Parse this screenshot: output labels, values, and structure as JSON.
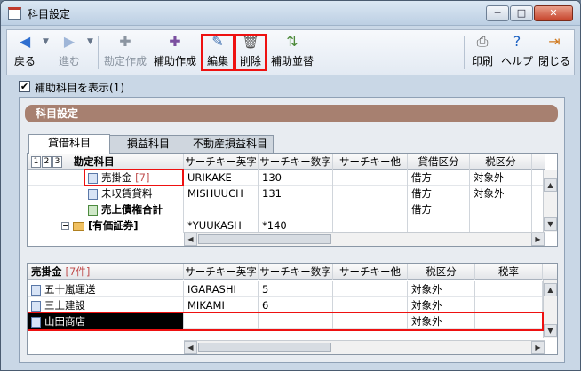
{
  "window": {
    "title": "科目設定",
    "controls": {
      "minimize": "─",
      "maximize": "□",
      "close": "✕"
    }
  },
  "toolbar": {
    "back": "戻る",
    "forward": "進む",
    "default_create": "勘定作成",
    "sub_create": "補助作成",
    "edit": "編集",
    "delete": "削除",
    "sub_reorder": "補助並替",
    "print": "印刷",
    "help": "ヘルプ",
    "close": "閉じる"
  },
  "show_sub": {
    "label": "補助科目を表示(1)",
    "checked": "✔"
  },
  "panel": {
    "title": "科目設定"
  },
  "tabs": [
    "貸借科目",
    "損益科目",
    "不動産損益科目"
  ],
  "grid_top": {
    "levels": [
      "1",
      "2",
      "3"
    ],
    "columns": [
      "勘定科目",
      "サーチキー英字",
      "サーチキー数字",
      "サーチキー他",
      "貸借区分",
      "税区分"
    ],
    "rows": [
      {
        "name": "売掛金",
        "count": "[7]",
        "eng": "URIKAKE",
        "num": "130",
        "other": "",
        "lend": "借方",
        "tax": "対象外"
      },
      {
        "name": "未収賃貸料",
        "count": "",
        "eng": "MISHUUCH",
        "num": "131",
        "other": "",
        "lend": "借方",
        "tax": "対象外"
      },
      {
        "name": "売上債権合計",
        "count": "",
        "eng": "",
        "num": "",
        "other": "",
        "lend": "借方",
        "tax": ""
      },
      {
        "name": "[有価証券]",
        "count": "",
        "eng": "*YUUKASH",
        "num": "*140",
        "other": "",
        "lend": "",
        "tax": ""
      }
    ]
  },
  "grid_bottom": {
    "header_name": "売掛金",
    "header_count": "[7件]",
    "columns": [
      "サーチキー英字",
      "サーチキー数字",
      "サーチキー他",
      "税区分",
      "税率"
    ],
    "rows": [
      {
        "name": "五十嵐運送",
        "eng": "IGARASHI",
        "num": "5",
        "other": "",
        "tax": "対象外",
        "rate": ""
      },
      {
        "name": "三上建設",
        "eng": "MIKAMI",
        "num": "6",
        "other": "",
        "tax": "対象外",
        "rate": ""
      },
      {
        "name": "山田商店",
        "eng": "",
        "num": "",
        "other": "",
        "tax": "対象外",
        "rate": ""
      }
    ]
  },
  "colors": {
    "accent": "#a78070",
    "highlight": "#e11111",
    "selected": "#000000"
  }
}
